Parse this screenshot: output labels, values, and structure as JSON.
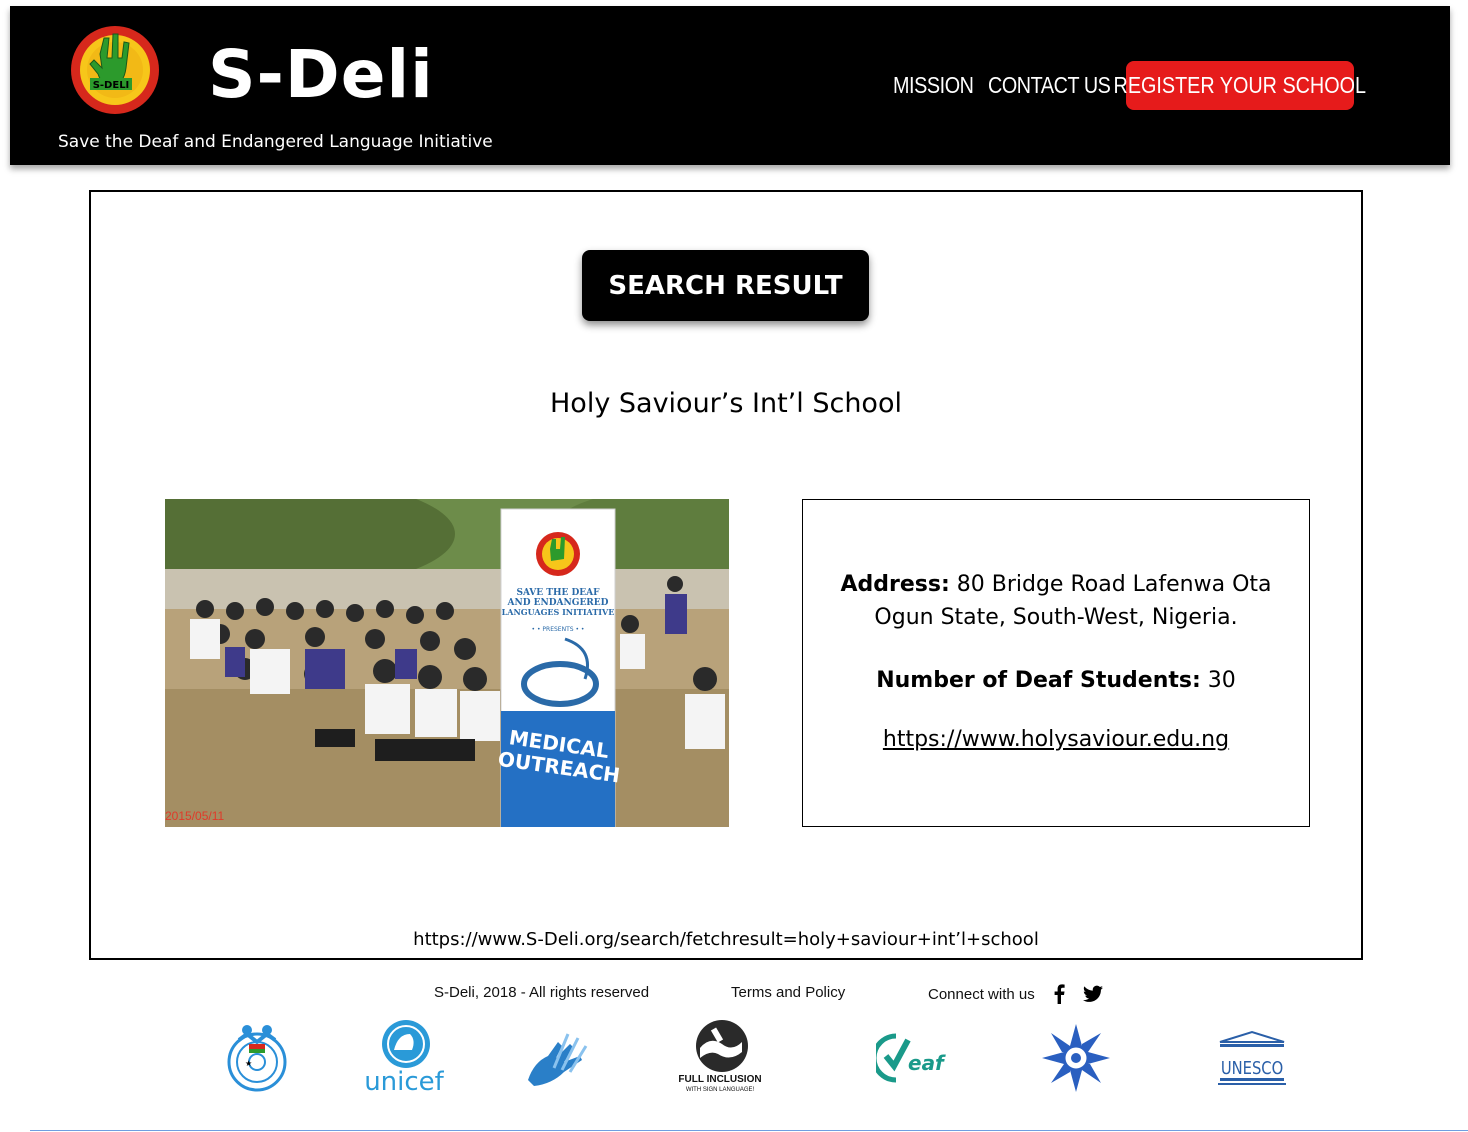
{
  "header": {
    "brand": "S-Deli",
    "logo_text": "S-DELI",
    "logo_ring_text": "SAVE THE DEAF & ENDANGERED LANGUAGES INITIATIVE",
    "tagline": "Save the Deaf and Endangered Language Initiative",
    "nav": {
      "mission": "MISSION",
      "contact": "CONTACT US",
      "register": "REGISTER YOUR SCHOOL"
    },
    "colors": {
      "background": "#000000",
      "register": "#e61b1b"
    }
  },
  "main": {
    "search_button": "SEARCH RESULT",
    "school_name": "Holy Saviour’s Int’l School",
    "photo": {
      "date_stamp": "2015/05/11",
      "banner_lines": [
        "SAVE THE DEAF",
        "AND ENDANGERED",
        "LANGUAGES INITIATIVE",
        "• • PRESENTS • •",
        "MEDICAL",
        "OUTREACH"
      ]
    },
    "info": {
      "address_label": "Address:",
      "address_value": " 80 Bridge Road Lafenwa Ota Ogun State, South-West, Nigeria.",
      "students_label": "Number of Deaf Students:",
      "students_value": " 30",
      "website": "https://www.holysaviour.edu.ng"
    },
    "url": "https://www.S-Deli.org/search/fetchresult=holy+saviour+int’l+school"
  },
  "footer": {
    "copyright": "S-Deli, 2018 - All rights reserved",
    "terms": "Terms and Policy",
    "connect": "Connect with us",
    "social_icons": [
      "facebook-icon",
      "twitter-icon"
    ],
    "partners": {
      "unicef": "unicef",
      "deaf": "eaf",
      "inclusion_line1": "FULL INCLUSION",
      "inclusion_line2": "WITH SIGN LANGUAGE!",
      "unesco": "UNESCO"
    }
  }
}
